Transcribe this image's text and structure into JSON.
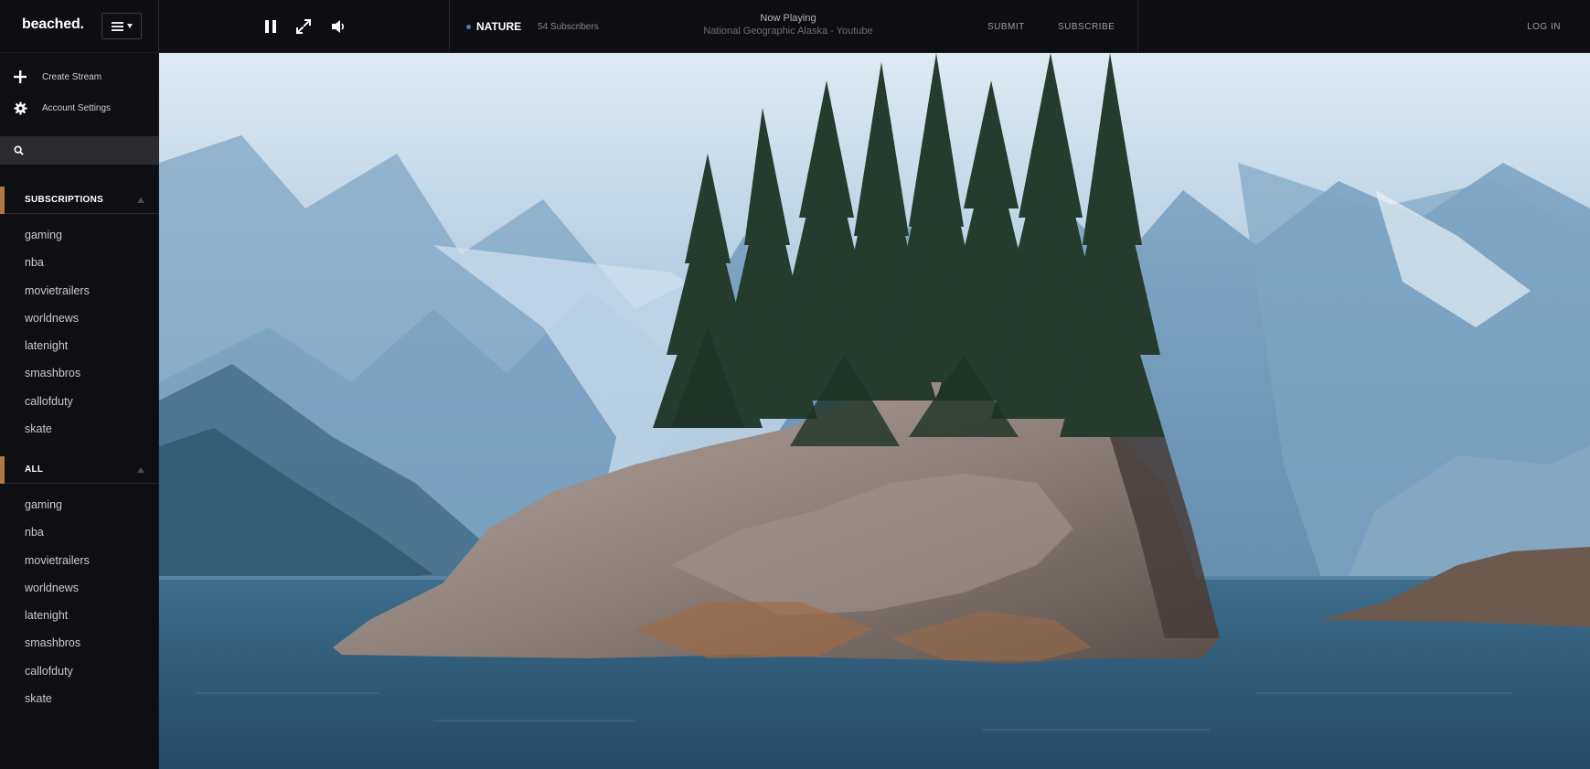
{
  "app": {
    "logo": "beached."
  },
  "topbar": {
    "channel": "NATURE",
    "subscribers": "54 Subscribers",
    "now_playing_label": "Now Playing",
    "now_playing_title": "National Geographic Alaska - Youtube",
    "submit": "SUBMIT",
    "subscribe": "SUBSCRIBE",
    "login": "LOG IN",
    "channel_dot_color": "#3b82c4"
  },
  "sidebar": {
    "create_stream": "Create Stream",
    "account_settings": "Account Settings",
    "search": {
      "value": "",
      "placeholder": ""
    },
    "subscriptions_title": "SUBSCRIPTIONS",
    "subscriptions": [
      "gaming",
      "nba",
      "movietrailers",
      "worldnews",
      "latenight",
      "smashbros",
      "callofduty",
      "skate"
    ],
    "all_title": "ALL",
    "all": [
      "gaming",
      "nba",
      "movietrailers",
      "worldnews",
      "latenight",
      "smashbros",
      "callofduty",
      "skate"
    ],
    "accent_color": "#a97a46"
  },
  "icons": {
    "menu": "hamburger-icon",
    "pause": "pause-icon",
    "fullscreen": "expand-icon",
    "volume": "volume-icon",
    "create": "plus-icon",
    "settings": "gear-icon",
    "search": "search-icon"
  }
}
